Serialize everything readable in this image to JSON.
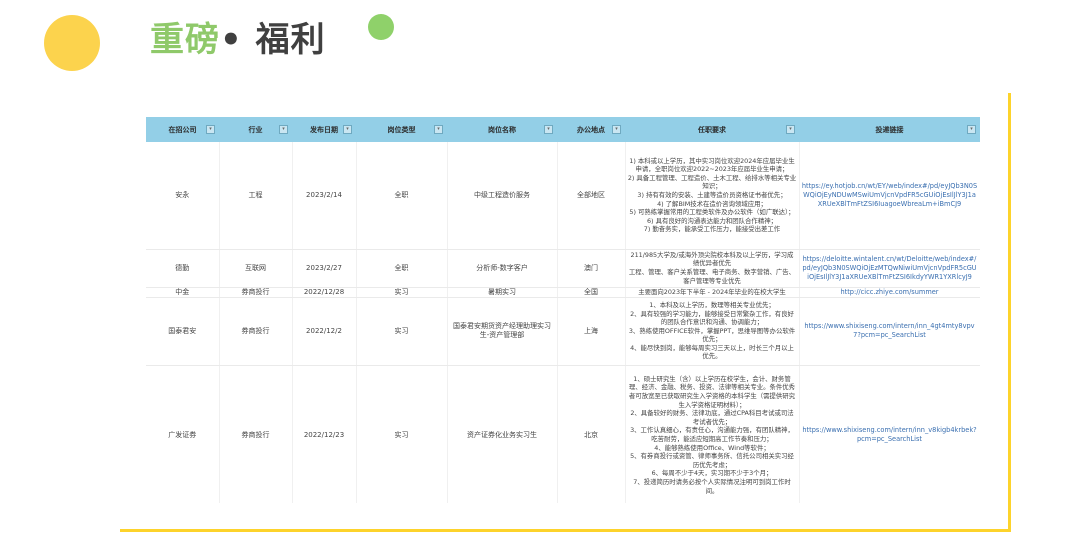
{
  "header": {
    "title_accent": "重磅",
    "title_rest": "• 福利"
  },
  "table": {
    "columns": [
      "在招公司",
      "行业",
      "发布日期",
      "岗位类型",
      "岗位名称",
      "办公地点",
      "任职要求",
      "投递链接"
    ],
    "filter_glyph": "▾",
    "rows": [
      {
        "company": "安永",
        "industry": "工程",
        "date": "2023/2/14",
        "type": "全职",
        "position": "中级工程造价服务",
        "location": "全部地区",
        "requirements": [
          "1) 本科或以上学历，其中实习岗位欢迎2024年应届毕业生申请，全职岗位欢迎2022~2023年应届毕业生申请；",
          "2) 具备工程管理、工程造价、土木工程、给排水等相关专业知识；",
          "3) 持有有效的安装、土建等造价员资格证书者优先；",
          "4) 了解BIM技术在造价咨询领域应用；",
          "5) 可熟练掌握常用的工程类软件及办公软件（如广联达）；",
          "6) 具有良好的沟通表达能力和团队合作精神；",
          "7) 勤奋务实，能承受工作压力，能接受出差工作"
        ],
        "link": "https://ey.hotjob.cn/wt/EY/web/index#/pd/eyJQb3N0SWQiOjEyNDUwMSwiUmVjcnVpdFR5cGUiOjEsIlJlY3J1aXRUeXBlTmFtZSI6IuagoeWbreaLm+iBmCJ9"
      },
      {
        "company": "德勤",
        "industry": "互联网",
        "date": "2023/2/27",
        "type": "全职",
        "position": "分析师-数字客户",
        "location": "澳门",
        "requirements": [
          "211/985大学及/或海外顶尖院校本科及以上学历，学习成绩优异者优先",
          "工程、管理、客户关系管理、电子商务、数字营销、广告、客户管理等专业优先"
        ],
        "link": "https://deloitte.wintalent.cn/wt/Deloitte/web/index#/pd/eyJQb3N0SWQiOjEzMTQwNiwiUmVjcnVpdFR5cGUiOjEsIlJlY3J1aXRUeXBlTmFtZSI6IkdyYWR1YXRlcyJ9"
      },
      {
        "company": "中金",
        "industry": "券商投行",
        "date": "2022/12/28",
        "type": "实习",
        "position": "暑期实习",
        "location": "全国",
        "requirements": [
          "主要面向2023年下半年 - 2024年毕业的在校大学生"
        ],
        "link": "http://cicc.zhiye.com/summer"
      },
      {
        "company": "国泰君安",
        "industry": "券商投行",
        "date": "2022/12/2",
        "type": "实习",
        "position": "国泰君安期货资产经理助理实习生-资产管理部",
        "location": "上海",
        "requirements": [
          "1、本科及以上学历，数理等相关专业优先；",
          "2、具有较强的学习能力，能够接受日常繁杂工作，有良好的团队合作意识和沟通、协调能力；",
          "3、熟练使用OFFICE软件，掌握PPT，思维导图等办公软件优先；",
          "4、能尽快到岗，能够每周实习三天以上，时长三个月以上优先。"
        ],
        "link": "https://www.shixiseng.com/intern/inn_4gt4mty8vpv7?pcm=pc_SearchList"
      },
      {
        "company": "广发证券",
        "industry": "券商投行",
        "date": "2022/12/23",
        "type": "实习",
        "position": "资产证券化业务实习生",
        "location": "北京",
        "requirements": [
          "1、硕士研究生（含）以上学历在校学生，会计、财务管理、经济、金融、税务、投资、法律等相关专业。条件优秀者可放宽至已获取研究生入学资格的本科学生（需提供研究生入学资格证明材料）；",
          "2、具备较好的财务、法律功底，通过CPA科目考试或司法考试者优先；",
          "3、工作认真细心，有责任心，沟通能力强，有团队精神，吃苦耐劳，能适应短期高工作节奏和压力；",
          "4、能够熟练使用Office、Wind等软件；",
          "5、有券商投行或资管、律师事务所、信托公司相关实习经历优先考虑；",
          "6、每周不少于4天，实习期不少于3个月；",
          "7、投递简历时请务必按个人实际情况注明可到岗工作时间。"
        ],
        "link": "https://www.shixiseng.com/intern/inn_v8kigb4krbek?pcm=pc_SearchList"
      }
    ]
  },
  "colors": {
    "accent_green": "#8fc96a",
    "accent_yellow": "#fdd32b",
    "header_blue": "#93cfe7"
  }
}
